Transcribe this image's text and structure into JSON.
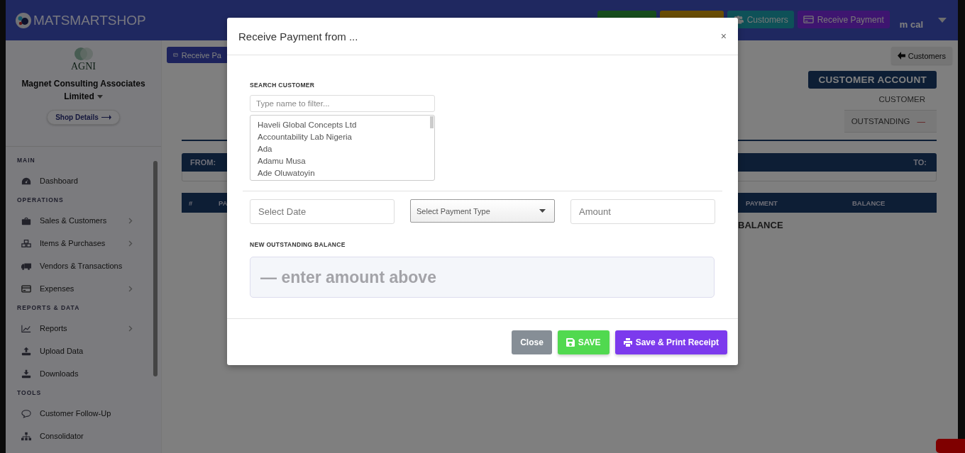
{
  "header": {
    "brand": "MATSMARTSHOP",
    "nav_buttons": [
      {
        "kind": "blank"
      },
      {
        "kind": "blank"
      },
      {
        "kind": "users",
        "label": "Customers"
      },
      {
        "kind": "card",
        "label": "Receive Payment"
      }
    ],
    "user": "m cal"
  },
  "sidebar": {
    "logo_text": "AGNI",
    "company": "Magnet Consulting Associates Limited",
    "shop_button": "Shop Details",
    "sections": [
      {
        "title": "MAIN",
        "items": [
          {
            "label": "Dashboard",
            "has_submenu": false
          }
        ]
      },
      {
        "title": "OPERATIONS",
        "items": [
          {
            "label": "Sales & Customers",
            "has_submenu": true
          },
          {
            "label": "Items & Purchases",
            "has_submenu": true
          },
          {
            "label": "Vendors & Transactions",
            "has_submenu": false
          },
          {
            "label": "Expenses",
            "has_submenu": true
          }
        ]
      },
      {
        "title": "REPORTS & DATA",
        "items": [
          {
            "label": "Reports",
            "has_submenu": true
          },
          {
            "label": "Upload Data",
            "has_submenu": false
          },
          {
            "label": "Downloads",
            "has_submenu": false
          }
        ]
      },
      {
        "title": "TOOLS",
        "items": [
          {
            "label": "Customer Follow-Up",
            "has_submenu": false
          },
          {
            "label": "Consolidator",
            "has_submenu": false
          }
        ]
      }
    ]
  },
  "main": {
    "receive_button": "Receive Pa",
    "back_button": "Customers",
    "account_title": "CUSTOMER ACCOUNT",
    "summary": [
      {
        "label": "CUSTOMER"
      },
      {
        "label": "OUTSTANDING",
        "value": "—"
      }
    ],
    "range_bar": {
      "from": "FROM:",
      "to": "TO:"
    },
    "table": {
      "columns": [
        "#",
        "PA",
        "PAYMENT",
        "BALANCE"
      ]
    },
    "balance_row": "BALANCE"
  },
  "modal": {
    "title": "Receive Payment from ...",
    "close": "×",
    "search_label": "SEARCH CUSTOMER",
    "search": {
      "placeholder": "Type name to filter..."
    },
    "customers": [
      {
        "name": "Haveli Global Concepts Ltd",
        "selected": false
      },
      {
        "name": "Accountability Lab Nigeria",
        "selected": false
      },
      {
        "name": "Ada",
        "selected": false
      },
      {
        "name": "Adamu Musa",
        "selected": false
      },
      {
        "name": "Ade Oluwatoyin",
        "selected": false
      }
    ],
    "date": {
      "placeholder": "Select Date"
    },
    "payment_type": {
      "value": "Select Payment Type"
    },
    "amount": {
      "placeholder": "Amount"
    },
    "balance_label": "NEW OUTSTANDING BALANCE",
    "balance_text": "— enter amount above",
    "buttons": [
      {
        "label": "Close",
        "kind": "close"
      },
      {
        "label": "SAVE",
        "kind": "save"
      },
      {
        "label": "Save & Print Receipt",
        "kind": "print"
      }
    ]
  }
}
